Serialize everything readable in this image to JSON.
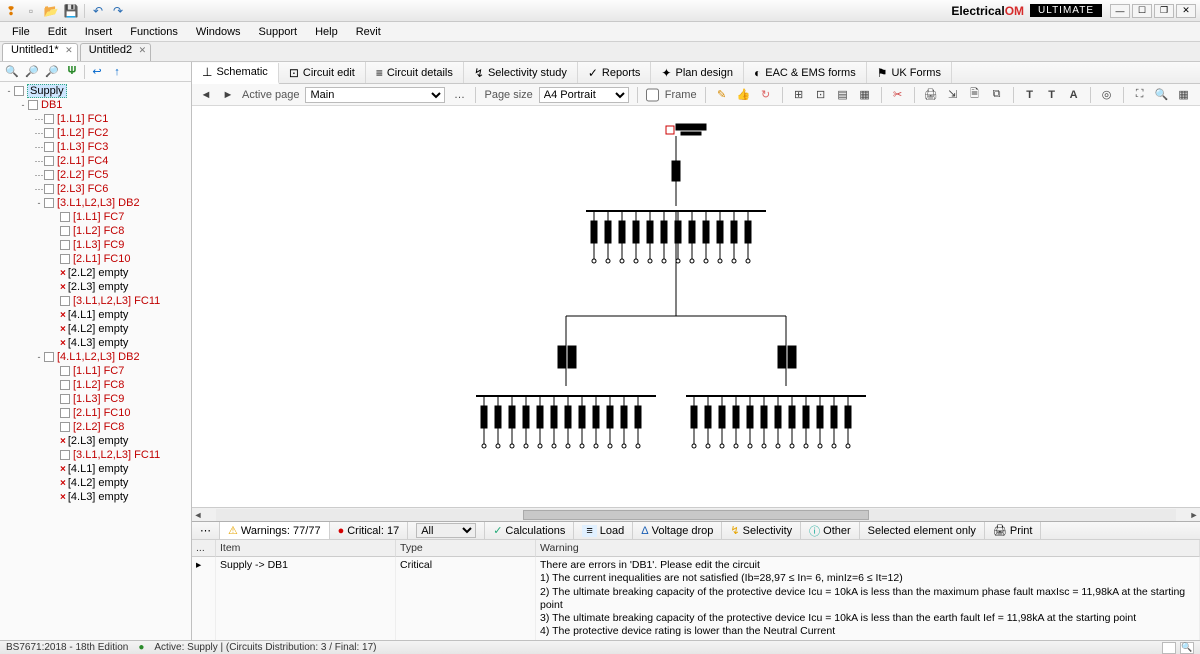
{
  "title": {
    "brand_left": "Electrical",
    "brand_right": "OM",
    "edition": "ULTIMATE"
  },
  "titlebar_icons": [
    "bulb",
    "new",
    "open",
    "save",
    "sep",
    "undo",
    "redo"
  ],
  "menu": [
    "File",
    "Edit",
    "Insert",
    "Functions",
    "Windows",
    "Support",
    "Help",
    "Revit"
  ],
  "doc_tabs": [
    {
      "label": "Untitled1*",
      "active": true
    },
    {
      "label": "Untitled2",
      "active": false
    }
  ],
  "left_toolbar": [
    "search",
    "zoom-in",
    "zoom-out",
    "script",
    "back",
    "up"
  ],
  "tree": [
    {
      "d": 0,
      "exp": "-",
      "lbl": "Supply",
      "cls": "sel"
    },
    {
      "d": 1,
      "exp": "-",
      "lbl": "DB1",
      "cls": "red"
    },
    {
      "d": 2,
      "exp": "",
      "lbl": "[1.L1] FC1",
      "cls": "red",
      "dot": true
    },
    {
      "d": 2,
      "exp": "",
      "lbl": "[1.L2] FC2",
      "cls": "red",
      "dot": true
    },
    {
      "d": 2,
      "exp": "",
      "lbl": "[1.L3] FC3",
      "cls": "red",
      "dot": true
    },
    {
      "d": 2,
      "exp": "",
      "lbl": "[2.L1] FC4",
      "cls": "red",
      "dot": true
    },
    {
      "d": 2,
      "exp": "",
      "lbl": "[2.L2] FC5",
      "cls": "red",
      "dot": true
    },
    {
      "d": 2,
      "exp": "",
      "lbl": "[2.L3] FC6",
      "cls": "red",
      "dot": true
    },
    {
      "d": 2,
      "exp": "-",
      "lbl": "[3.L1,L2,L3] DB2",
      "cls": "red"
    },
    {
      "d": 3,
      "exp": "",
      "lbl": "[1.L1] FC7",
      "cls": "red"
    },
    {
      "d": 3,
      "exp": "",
      "lbl": "[1.L2] FC8",
      "cls": "red"
    },
    {
      "d": 3,
      "exp": "",
      "lbl": "[1.L3] FC9",
      "cls": "red"
    },
    {
      "d": 3,
      "exp": "",
      "lbl": "[2.L1] FC10",
      "cls": "red"
    },
    {
      "d": 3,
      "exp": "",
      "lbl": "[2.L2] empty",
      "cls": "",
      "x": true
    },
    {
      "d": 3,
      "exp": "",
      "lbl": "[2.L3] empty",
      "cls": "",
      "x": true
    },
    {
      "d": 3,
      "exp": "",
      "lbl": "[3.L1,L2,L3] FC11",
      "cls": "red"
    },
    {
      "d": 3,
      "exp": "",
      "lbl": "[4.L1] empty",
      "cls": "",
      "x": true
    },
    {
      "d": 3,
      "exp": "",
      "lbl": "[4.L2] empty",
      "cls": "",
      "x": true
    },
    {
      "d": 3,
      "exp": "",
      "lbl": "[4.L3] empty",
      "cls": "",
      "x": true
    },
    {
      "d": 2,
      "exp": "-",
      "lbl": "[4.L1,L2,L3] DB2",
      "cls": "red"
    },
    {
      "d": 3,
      "exp": "",
      "lbl": "[1.L1] FC7",
      "cls": "red"
    },
    {
      "d": 3,
      "exp": "",
      "lbl": "[1.L2] FC8",
      "cls": "red"
    },
    {
      "d": 3,
      "exp": "",
      "lbl": "[1.L3] FC9",
      "cls": "red"
    },
    {
      "d": 3,
      "exp": "",
      "lbl": "[2.L1] FC10",
      "cls": "red"
    },
    {
      "d": 3,
      "exp": "",
      "lbl": "[2.L2] FC8",
      "cls": "red"
    },
    {
      "d": 3,
      "exp": "",
      "lbl": "[2.L3] empty",
      "cls": "",
      "x": true
    },
    {
      "d": 3,
      "exp": "",
      "lbl": "[3.L1,L2,L3] FC11",
      "cls": "red"
    },
    {
      "d": 3,
      "exp": "",
      "lbl": "[4.L1] empty",
      "cls": "",
      "x": true
    },
    {
      "d": 3,
      "exp": "",
      "lbl": "[4.L2] empty",
      "cls": "",
      "x": true
    },
    {
      "d": 3,
      "exp": "",
      "lbl": "[4.L3] empty",
      "cls": "",
      "x": true
    }
  ],
  "ribbon": [
    {
      "icon": "⊥",
      "label": "Schematic",
      "active": true
    },
    {
      "icon": "⊡",
      "label": "Circuit edit"
    },
    {
      "icon": "≡",
      "label": "Circuit details"
    },
    {
      "icon": "↯",
      "label": "Selectivity study"
    },
    {
      "icon": "✓",
      "label": "Reports"
    },
    {
      "icon": "✦",
      "label": "Plan design"
    },
    {
      "icon": "◐",
      "label": "EAC & EMS forms"
    },
    {
      "icon": "⚑",
      "label": "UK Forms"
    }
  ],
  "subbar": {
    "active_page_label": "Active page",
    "active_page_value": "Main",
    "page_size_label": "Page size",
    "page_size_value": "A4 Portrait",
    "frame_label": "Frame"
  },
  "bottom_bar": {
    "warnings": "Warnings: 77/77",
    "critical": "Critical: 17",
    "filter": "All",
    "tags": [
      "Calculations",
      "Load",
      "Voltage drop",
      "Selectivity",
      "Other"
    ],
    "selected": "Selected element only",
    "print": "Print"
  },
  "grid": {
    "headers": [
      "...",
      "Item",
      "Type",
      "Warning"
    ],
    "row": {
      "item": "Supply  -> DB1",
      "type": "Critical",
      "lines": [
        "There are errors in 'DB1'. Please edit the circuit",
        "1) The current inequalities are not satisfied (Ib=28,97 ≤ In= 6, minIz=6 ≤ It=12)",
        "2) The ultimate breaking capacity of the protective device Icu = 10kA is less than the maximum phase fault maxIsc = 11,98kA at the starting point",
        "3) The ultimate breaking capacity of the protective device Icu = 10kA is less than the earth fault Ief = 11,98kA at the starting point",
        "4) The protective device rating is lower than the Neutral Current"
      ]
    }
  },
  "status": {
    "left": "BS7671:2018 - 18th Edition",
    "mid": "Active: Supply | (Circuits Distribution: 3 / Final: 17)"
  }
}
